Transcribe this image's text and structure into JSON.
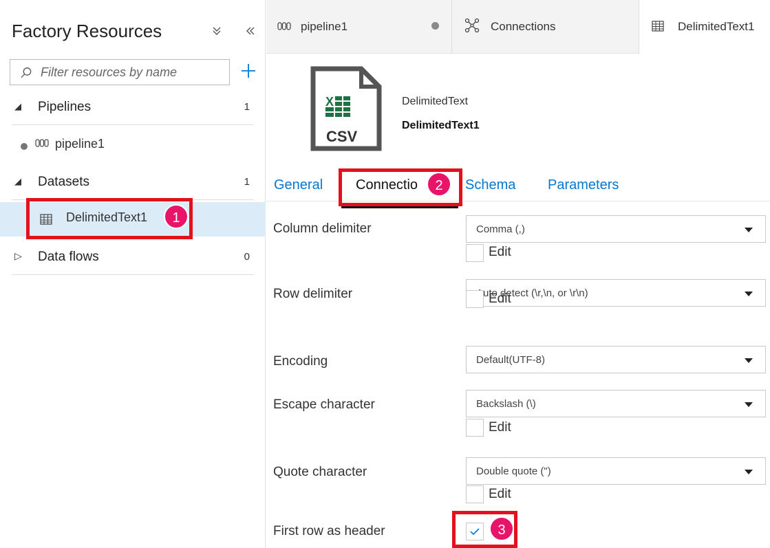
{
  "sidebar": {
    "title": "Factory Resources",
    "collapse_all_icon": "double-chevron-down-icon",
    "collapse_panel_icon": "double-chevron-left-icon",
    "filter_placeholder": "Filter resources by name",
    "add_icon": "plus-icon",
    "sections": [
      {
        "label": "Pipelines",
        "count": "1",
        "expanded": true
      },
      {
        "label": "Datasets",
        "count": "1",
        "expanded": true
      },
      {
        "label": "Data flows",
        "count": "0",
        "expanded": false
      }
    ],
    "pipeline_item": "pipeline1",
    "dataset_item": "DelimitedText1"
  },
  "tabs": [
    {
      "label": "pipeline1",
      "icon": "pipeline-icon",
      "unsaved": true
    },
    {
      "label": "Connections",
      "icon": "connections-icon"
    },
    {
      "label": "DelimitedText1",
      "icon": "table-icon",
      "active": true
    }
  ],
  "dataset": {
    "file_icon_text": "CSV",
    "type": "DelimitedText",
    "name": "DelimitedText1"
  },
  "inner_tabs": [
    {
      "label": "General"
    },
    {
      "label": "Connectio",
      "active": true
    },
    {
      "label": "Schema"
    },
    {
      "label": "Parameters"
    }
  ],
  "form": {
    "column_delimiter": {
      "label": "Column delimiter",
      "value": "Comma (,)",
      "edit_label": "Edit"
    },
    "row_delimiter": {
      "label": "Row delimiter",
      "value": "Auto detect (\\r,\\n, or \\r\\n)",
      "edit_label": "Edit"
    },
    "encoding": {
      "label": "Encoding",
      "value": "Default(UTF-8)"
    },
    "escape_character": {
      "label": "Escape character",
      "value": "Backslash (\\)",
      "edit_label": "Edit"
    },
    "quote_character": {
      "label": "Quote character",
      "value": "Double quote (\")",
      "edit_label": "Edit"
    },
    "first_row_header": {
      "label": "First row as header",
      "checked": true
    }
  },
  "annotations": {
    "badge1": "1",
    "badge2": "2",
    "badge3": "3",
    "highlight_color": "#e3101e",
    "badge_color": "#e8146a"
  },
  "colors": {
    "accent": "#0078d4",
    "selected_bg": "#dcebf8",
    "csv_green": "#1e7145"
  }
}
